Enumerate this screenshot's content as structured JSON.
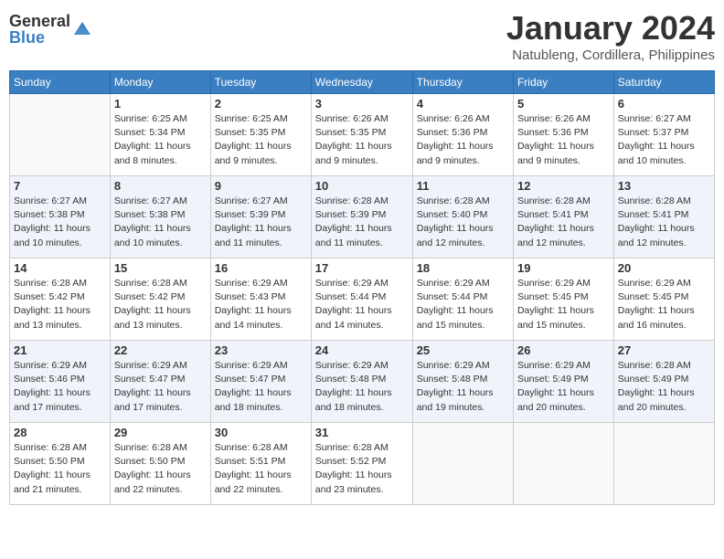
{
  "logo": {
    "general": "General",
    "blue": "Blue"
  },
  "title": "January 2024",
  "location": "Natubleng, Cordillera, Philippines",
  "weekdays": [
    "Sunday",
    "Monday",
    "Tuesday",
    "Wednesday",
    "Thursday",
    "Friday",
    "Saturday"
  ],
  "weeks": [
    [
      {
        "day": "",
        "sunrise": "",
        "sunset": "",
        "daylight": ""
      },
      {
        "day": "1",
        "sunrise": "Sunrise: 6:25 AM",
        "sunset": "Sunset: 5:34 PM",
        "daylight": "Daylight: 11 hours and 8 minutes."
      },
      {
        "day": "2",
        "sunrise": "Sunrise: 6:25 AM",
        "sunset": "Sunset: 5:35 PM",
        "daylight": "Daylight: 11 hours and 9 minutes."
      },
      {
        "day": "3",
        "sunrise": "Sunrise: 6:26 AM",
        "sunset": "Sunset: 5:35 PM",
        "daylight": "Daylight: 11 hours and 9 minutes."
      },
      {
        "day": "4",
        "sunrise": "Sunrise: 6:26 AM",
        "sunset": "Sunset: 5:36 PM",
        "daylight": "Daylight: 11 hours and 9 minutes."
      },
      {
        "day": "5",
        "sunrise": "Sunrise: 6:26 AM",
        "sunset": "Sunset: 5:36 PM",
        "daylight": "Daylight: 11 hours and 9 minutes."
      },
      {
        "day": "6",
        "sunrise": "Sunrise: 6:27 AM",
        "sunset": "Sunset: 5:37 PM",
        "daylight": "Daylight: 11 hours and 10 minutes."
      }
    ],
    [
      {
        "day": "7",
        "sunrise": "Sunrise: 6:27 AM",
        "sunset": "Sunset: 5:38 PM",
        "daylight": "Daylight: 11 hours and 10 minutes."
      },
      {
        "day": "8",
        "sunrise": "Sunrise: 6:27 AM",
        "sunset": "Sunset: 5:38 PM",
        "daylight": "Daylight: 11 hours and 10 minutes."
      },
      {
        "day": "9",
        "sunrise": "Sunrise: 6:27 AM",
        "sunset": "Sunset: 5:39 PM",
        "daylight": "Daylight: 11 hours and 11 minutes."
      },
      {
        "day": "10",
        "sunrise": "Sunrise: 6:28 AM",
        "sunset": "Sunset: 5:39 PM",
        "daylight": "Daylight: 11 hours and 11 minutes."
      },
      {
        "day": "11",
        "sunrise": "Sunrise: 6:28 AM",
        "sunset": "Sunset: 5:40 PM",
        "daylight": "Daylight: 11 hours and 12 minutes."
      },
      {
        "day": "12",
        "sunrise": "Sunrise: 6:28 AM",
        "sunset": "Sunset: 5:41 PM",
        "daylight": "Daylight: 11 hours and 12 minutes."
      },
      {
        "day": "13",
        "sunrise": "Sunrise: 6:28 AM",
        "sunset": "Sunset: 5:41 PM",
        "daylight": "Daylight: 11 hours and 12 minutes."
      }
    ],
    [
      {
        "day": "14",
        "sunrise": "Sunrise: 6:28 AM",
        "sunset": "Sunset: 5:42 PM",
        "daylight": "Daylight: 11 hours and 13 minutes."
      },
      {
        "day": "15",
        "sunrise": "Sunrise: 6:28 AM",
        "sunset": "Sunset: 5:42 PM",
        "daylight": "Daylight: 11 hours and 13 minutes."
      },
      {
        "day": "16",
        "sunrise": "Sunrise: 6:29 AM",
        "sunset": "Sunset: 5:43 PM",
        "daylight": "Daylight: 11 hours and 14 minutes."
      },
      {
        "day": "17",
        "sunrise": "Sunrise: 6:29 AM",
        "sunset": "Sunset: 5:44 PM",
        "daylight": "Daylight: 11 hours and 14 minutes."
      },
      {
        "day": "18",
        "sunrise": "Sunrise: 6:29 AM",
        "sunset": "Sunset: 5:44 PM",
        "daylight": "Daylight: 11 hours and 15 minutes."
      },
      {
        "day": "19",
        "sunrise": "Sunrise: 6:29 AM",
        "sunset": "Sunset: 5:45 PM",
        "daylight": "Daylight: 11 hours and 15 minutes."
      },
      {
        "day": "20",
        "sunrise": "Sunrise: 6:29 AM",
        "sunset": "Sunset: 5:45 PM",
        "daylight": "Daylight: 11 hours and 16 minutes."
      }
    ],
    [
      {
        "day": "21",
        "sunrise": "Sunrise: 6:29 AM",
        "sunset": "Sunset: 5:46 PM",
        "daylight": "Daylight: 11 hours and 17 minutes."
      },
      {
        "day": "22",
        "sunrise": "Sunrise: 6:29 AM",
        "sunset": "Sunset: 5:47 PM",
        "daylight": "Daylight: 11 hours and 17 minutes."
      },
      {
        "day": "23",
        "sunrise": "Sunrise: 6:29 AM",
        "sunset": "Sunset: 5:47 PM",
        "daylight": "Daylight: 11 hours and 18 minutes."
      },
      {
        "day": "24",
        "sunrise": "Sunrise: 6:29 AM",
        "sunset": "Sunset: 5:48 PM",
        "daylight": "Daylight: 11 hours and 18 minutes."
      },
      {
        "day": "25",
        "sunrise": "Sunrise: 6:29 AM",
        "sunset": "Sunset: 5:48 PM",
        "daylight": "Daylight: 11 hours and 19 minutes."
      },
      {
        "day": "26",
        "sunrise": "Sunrise: 6:29 AM",
        "sunset": "Sunset: 5:49 PM",
        "daylight": "Daylight: 11 hours and 20 minutes."
      },
      {
        "day": "27",
        "sunrise": "Sunrise: 6:28 AM",
        "sunset": "Sunset: 5:49 PM",
        "daylight": "Daylight: 11 hours and 20 minutes."
      }
    ],
    [
      {
        "day": "28",
        "sunrise": "Sunrise: 6:28 AM",
        "sunset": "Sunset: 5:50 PM",
        "daylight": "Daylight: 11 hours and 21 minutes."
      },
      {
        "day": "29",
        "sunrise": "Sunrise: 6:28 AM",
        "sunset": "Sunset: 5:50 PM",
        "daylight": "Daylight: 11 hours and 22 minutes."
      },
      {
        "day": "30",
        "sunrise": "Sunrise: 6:28 AM",
        "sunset": "Sunset: 5:51 PM",
        "daylight": "Daylight: 11 hours and 22 minutes."
      },
      {
        "day": "31",
        "sunrise": "Sunrise: 6:28 AM",
        "sunset": "Sunset: 5:52 PM",
        "daylight": "Daylight: 11 hours and 23 minutes."
      },
      {
        "day": "",
        "sunrise": "",
        "sunset": "",
        "daylight": ""
      },
      {
        "day": "",
        "sunrise": "",
        "sunset": "",
        "daylight": ""
      },
      {
        "day": "",
        "sunrise": "",
        "sunset": "",
        "daylight": ""
      }
    ]
  ]
}
